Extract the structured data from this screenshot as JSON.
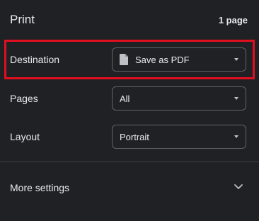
{
  "header": {
    "title": "Print",
    "page_count": "1 page"
  },
  "settings": {
    "destination": {
      "label": "Destination",
      "value": "Save as PDF",
      "icon": "document-icon"
    },
    "pages": {
      "label": "Pages",
      "value": "All"
    },
    "layout": {
      "label": "Layout",
      "value": "Portrait"
    }
  },
  "more_settings": {
    "label": "More settings",
    "icon": "chevron-down-icon"
  },
  "colors": {
    "background": "#202124",
    "text": "#e8eaed",
    "border": "#5f6368",
    "highlight": "#e01020"
  }
}
